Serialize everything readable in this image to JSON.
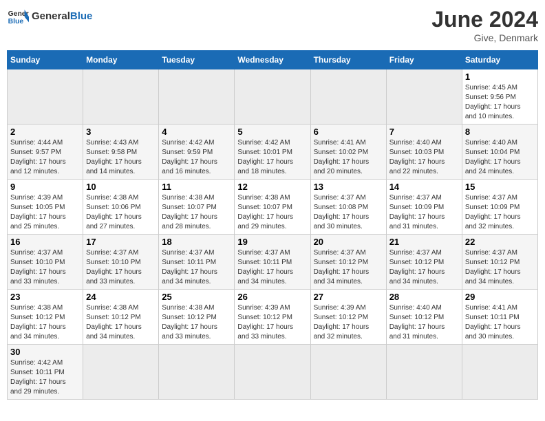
{
  "header": {
    "logo_general": "General",
    "logo_blue": "Blue",
    "month_title": "June 2024",
    "location": "Give, Denmark"
  },
  "weekdays": [
    "Sunday",
    "Monday",
    "Tuesday",
    "Wednesday",
    "Thursday",
    "Friday",
    "Saturday"
  ],
  "weeks": [
    [
      {
        "day": "",
        "info": ""
      },
      {
        "day": "",
        "info": ""
      },
      {
        "day": "",
        "info": ""
      },
      {
        "day": "",
        "info": ""
      },
      {
        "day": "",
        "info": ""
      },
      {
        "day": "",
        "info": ""
      },
      {
        "day": "1",
        "info": "Sunrise: 4:45 AM\nSunset: 9:56 PM\nDaylight: 17 hours\nand 10 minutes."
      }
    ],
    [
      {
        "day": "2",
        "info": "Sunrise: 4:44 AM\nSunset: 9:57 PM\nDaylight: 17 hours\nand 12 minutes."
      },
      {
        "day": "3",
        "info": "Sunrise: 4:43 AM\nSunset: 9:58 PM\nDaylight: 17 hours\nand 14 minutes."
      },
      {
        "day": "4",
        "info": "Sunrise: 4:42 AM\nSunset: 9:59 PM\nDaylight: 17 hours\nand 16 minutes."
      },
      {
        "day": "5",
        "info": "Sunrise: 4:42 AM\nSunset: 10:01 PM\nDaylight: 17 hours\nand 18 minutes."
      },
      {
        "day": "6",
        "info": "Sunrise: 4:41 AM\nSunset: 10:02 PM\nDaylight: 17 hours\nand 20 minutes."
      },
      {
        "day": "7",
        "info": "Sunrise: 4:40 AM\nSunset: 10:03 PM\nDaylight: 17 hours\nand 22 minutes."
      },
      {
        "day": "8",
        "info": "Sunrise: 4:40 AM\nSunset: 10:04 PM\nDaylight: 17 hours\nand 24 minutes."
      }
    ],
    [
      {
        "day": "9",
        "info": "Sunrise: 4:39 AM\nSunset: 10:05 PM\nDaylight: 17 hours\nand 25 minutes."
      },
      {
        "day": "10",
        "info": "Sunrise: 4:38 AM\nSunset: 10:06 PM\nDaylight: 17 hours\nand 27 minutes."
      },
      {
        "day": "11",
        "info": "Sunrise: 4:38 AM\nSunset: 10:07 PM\nDaylight: 17 hours\nand 28 minutes."
      },
      {
        "day": "12",
        "info": "Sunrise: 4:38 AM\nSunset: 10:07 PM\nDaylight: 17 hours\nand 29 minutes."
      },
      {
        "day": "13",
        "info": "Sunrise: 4:37 AM\nSunset: 10:08 PM\nDaylight: 17 hours\nand 30 minutes."
      },
      {
        "day": "14",
        "info": "Sunrise: 4:37 AM\nSunset: 10:09 PM\nDaylight: 17 hours\nand 31 minutes."
      },
      {
        "day": "15",
        "info": "Sunrise: 4:37 AM\nSunset: 10:09 PM\nDaylight: 17 hours\nand 32 minutes."
      }
    ],
    [
      {
        "day": "16",
        "info": "Sunrise: 4:37 AM\nSunset: 10:10 PM\nDaylight: 17 hours\nand 33 minutes."
      },
      {
        "day": "17",
        "info": "Sunrise: 4:37 AM\nSunset: 10:10 PM\nDaylight: 17 hours\nand 33 minutes."
      },
      {
        "day": "18",
        "info": "Sunrise: 4:37 AM\nSunset: 10:11 PM\nDaylight: 17 hours\nand 34 minutes."
      },
      {
        "day": "19",
        "info": "Sunrise: 4:37 AM\nSunset: 10:11 PM\nDaylight: 17 hours\nand 34 minutes."
      },
      {
        "day": "20",
        "info": "Sunrise: 4:37 AM\nSunset: 10:12 PM\nDaylight: 17 hours\nand 34 minutes."
      },
      {
        "day": "21",
        "info": "Sunrise: 4:37 AM\nSunset: 10:12 PM\nDaylight: 17 hours\nand 34 minutes."
      },
      {
        "day": "22",
        "info": "Sunrise: 4:37 AM\nSunset: 10:12 PM\nDaylight: 17 hours\nand 34 minutes."
      }
    ],
    [
      {
        "day": "23",
        "info": "Sunrise: 4:38 AM\nSunset: 10:12 PM\nDaylight: 17 hours\nand 34 minutes."
      },
      {
        "day": "24",
        "info": "Sunrise: 4:38 AM\nSunset: 10:12 PM\nDaylight: 17 hours\nand 34 minutes."
      },
      {
        "day": "25",
        "info": "Sunrise: 4:38 AM\nSunset: 10:12 PM\nDaylight: 17 hours\nand 33 minutes."
      },
      {
        "day": "26",
        "info": "Sunrise: 4:39 AM\nSunset: 10:12 PM\nDaylight: 17 hours\nand 33 minutes."
      },
      {
        "day": "27",
        "info": "Sunrise: 4:39 AM\nSunset: 10:12 PM\nDaylight: 17 hours\nand 32 minutes."
      },
      {
        "day": "28",
        "info": "Sunrise: 4:40 AM\nSunset: 10:12 PM\nDaylight: 17 hours\nand 31 minutes."
      },
      {
        "day": "29",
        "info": "Sunrise: 4:41 AM\nSunset: 10:11 PM\nDaylight: 17 hours\nand 30 minutes."
      }
    ],
    [
      {
        "day": "30",
        "info": "Sunrise: 4:42 AM\nSunset: 10:11 PM\nDaylight: 17 hours\nand 29 minutes."
      },
      {
        "day": "",
        "info": ""
      },
      {
        "day": "",
        "info": ""
      },
      {
        "day": "",
        "info": ""
      },
      {
        "day": "",
        "info": ""
      },
      {
        "day": "",
        "info": ""
      },
      {
        "day": "",
        "info": ""
      }
    ]
  ]
}
